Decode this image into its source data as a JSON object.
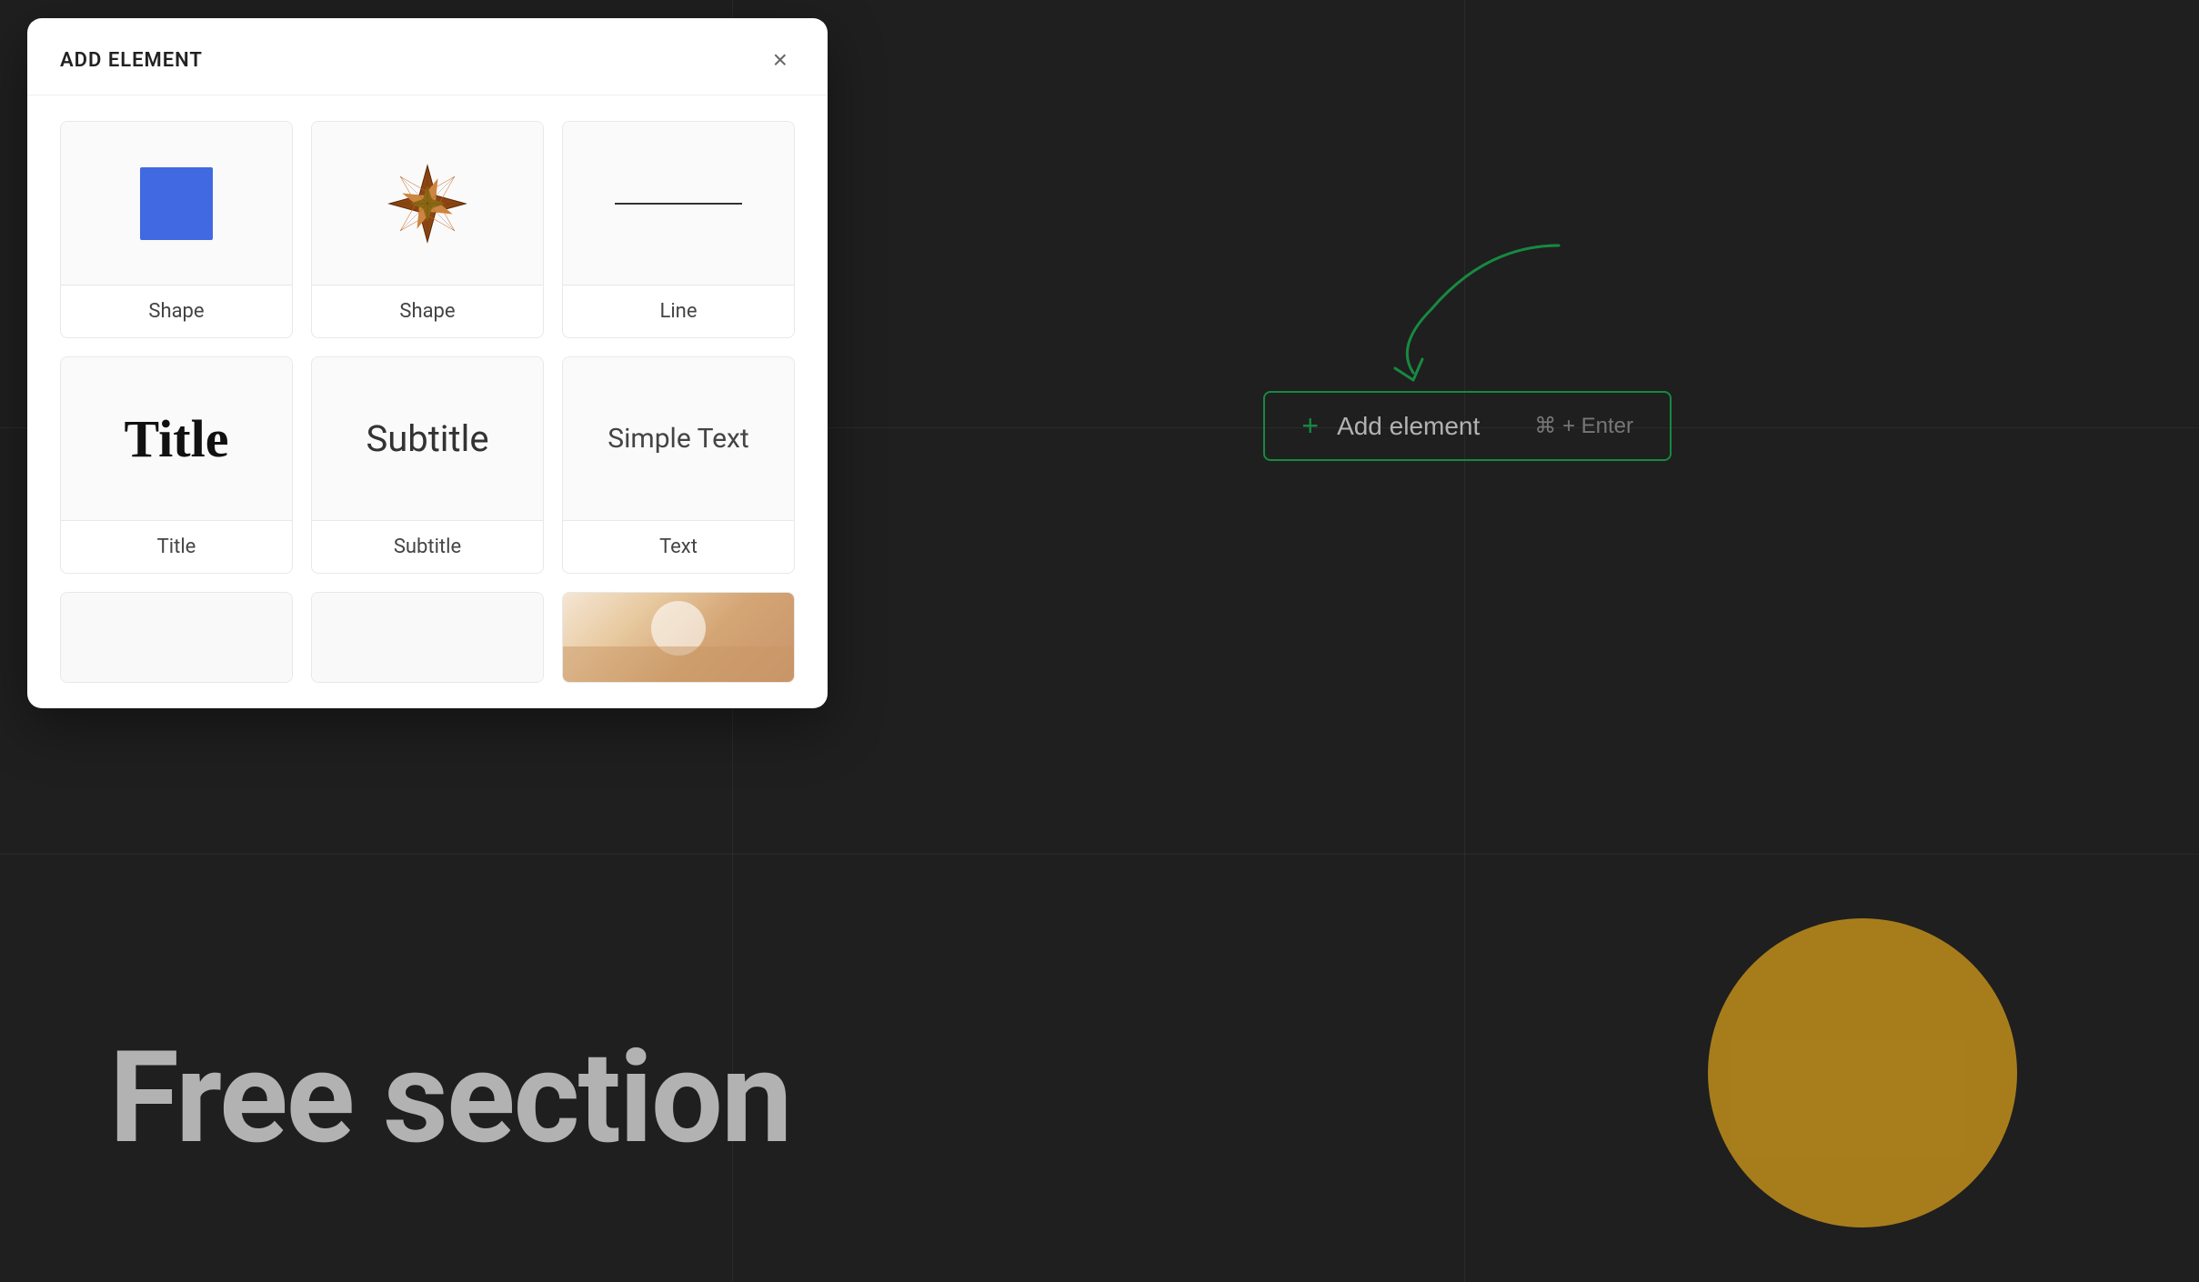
{
  "canvas": {
    "background_color": "#2d2d2d"
  },
  "modal": {
    "title": "ADD ELEMENT",
    "close_button": "×",
    "elements": [
      {
        "id": "shape-square",
        "label": "Shape",
        "type": "shape-square"
      },
      {
        "id": "shape-star",
        "label": "Shape",
        "type": "shape-star"
      },
      {
        "id": "line",
        "label": "Line",
        "type": "line"
      },
      {
        "id": "title",
        "label": "Title",
        "type": "title",
        "preview_text": "Title"
      },
      {
        "id": "subtitle",
        "label": "Subtitle",
        "type": "subtitle",
        "preview_text": "Subtitle"
      },
      {
        "id": "text",
        "label": "Text",
        "type": "text",
        "preview_text": "Simple Text"
      }
    ]
  },
  "add_element_button": {
    "label": "Add element",
    "shortcut": "⌘ + Enter",
    "plus_symbol": "+"
  },
  "free_section": {
    "text": "Free section"
  },
  "colors": {
    "green_border": "#22c55e",
    "yellow_circle": "#f0b429",
    "blue_square": "#4169e1"
  }
}
